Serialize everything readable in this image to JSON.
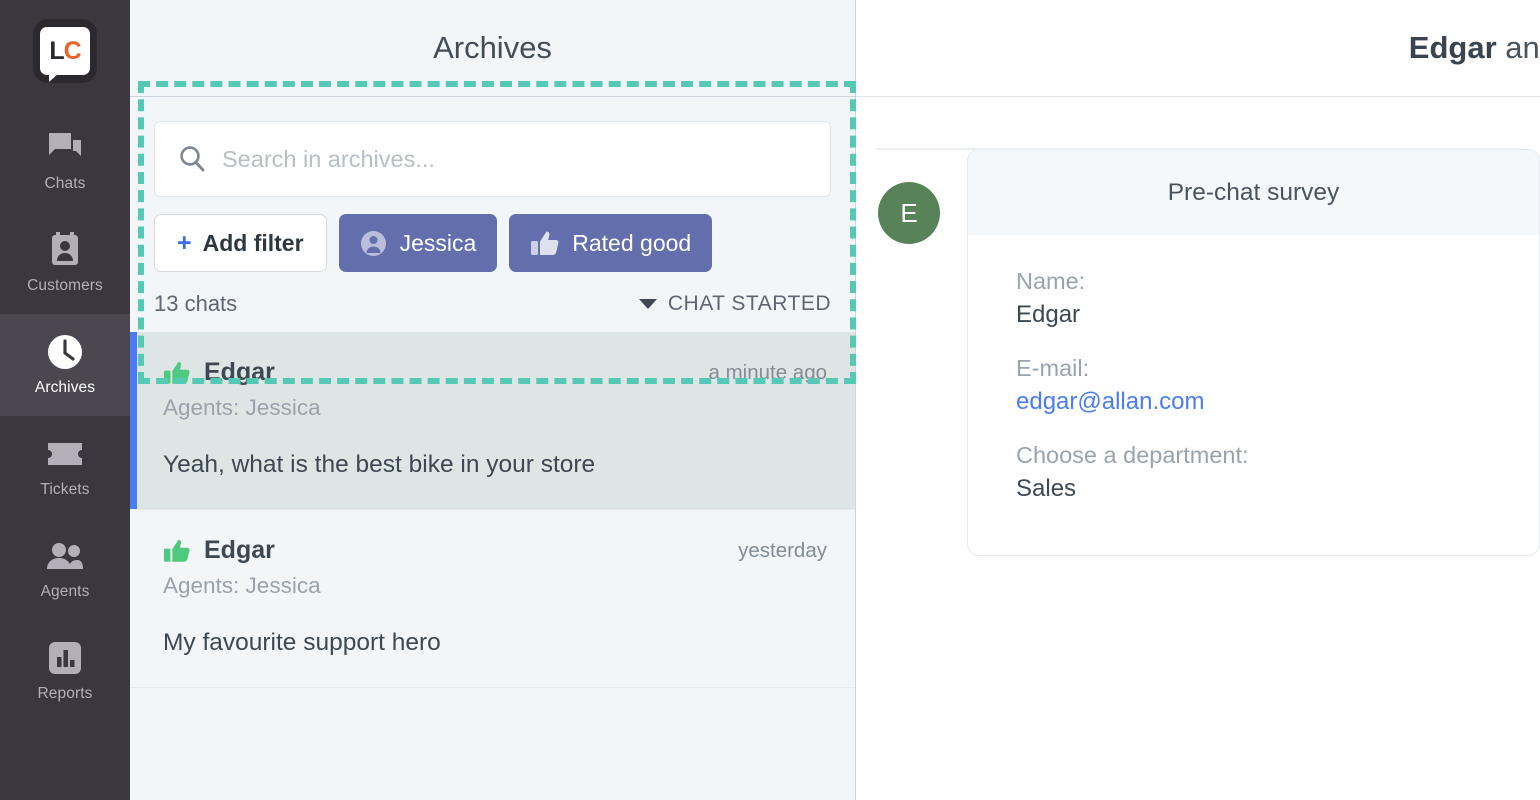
{
  "sidebar": {
    "logo": {
      "text_l": "L",
      "text_c": "C",
      "name": "livechat-logo"
    },
    "items": [
      {
        "label": "Chats",
        "icon": "chats-icon",
        "active": false
      },
      {
        "label": "Customers",
        "icon": "customers-icon",
        "active": false
      },
      {
        "label": "Archives",
        "icon": "clock-icon",
        "active": true
      },
      {
        "label": "Tickets",
        "icon": "ticket-icon",
        "active": false
      },
      {
        "label": "Agents",
        "icon": "agents-icon",
        "active": false
      },
      {
        "label": "Reports",
        "icon": "reports-icon",
        "active": false
      }
    ]
  },
  "archives": {
    "title": "Archives",
    "search": {
      "placeholder": "Search in archives...",
      "value": "",
      "icon": "search-icon"
    },
    "filters": {
      "add_label": "Add filter",
      "add_plus": "+",
      "applied": [
        {
          "label": "Jessica",
          "icon": "person-icon"
        },
        {
          "label": "Rated good",
          "icon": "thumbs-up-icon"
        }
      ]
    },
    "count_label": "13 chats",
    "sort_label": "CHAT STARTED",
    "sort_icon": "caret-down-icon",
    "chats": [
      {
        "rating_icon": "thumbs-up-icon",
        "name": "Edgar",
        "time": "a minute ago",
        "agents": "Agents: Jessica",
        "preview": "Yeah, what is the best bike in your store",
        "selected": true
      },
      {
        "rating_icon": "thumbs-up-icon",
        "name": "Edgar",
        "time": "yesterday",
        "agents": "Agents: Jessica",
        "preview": "My favourite support hero",
        "selected": false
      }
    ]
  },
  "conversation": {
    "title_bold": "Edgar",
    "title_rest": " and",
    "avatar_initial": "E",
    "survey": {
      "header": "Pre-chat survey",
      "fields": [
        {
          "label": "Name:",
          "value": "Edgar",
          "is_link": false
        },
        {
          "label": "E-mail:",
          "value": "edgar@allan.com",
          "is_link": true
        },
        {
          "label": "Choose a department:",
          "value": "Sales",
          "is_link": false
        }
      ]
    }
  },
  "colors": {
    "highlight_dashed": "#55c9b4",
    "rail_bg": "#3b373f",
    "rail_active_bg": "#4b4750",
    "pill_selected_bg": "#636fad",
    "selected_chat_bg": "#dde6e5",
    "selected_chat_accent": "#4a7cf5",
    "thumbs_up_green": "#4ec97e",
    "avatar_green": "#588257",
    "link_blue": "#4a7cf5",
    "panel_bg": "#f2f6f8"
  }
}
